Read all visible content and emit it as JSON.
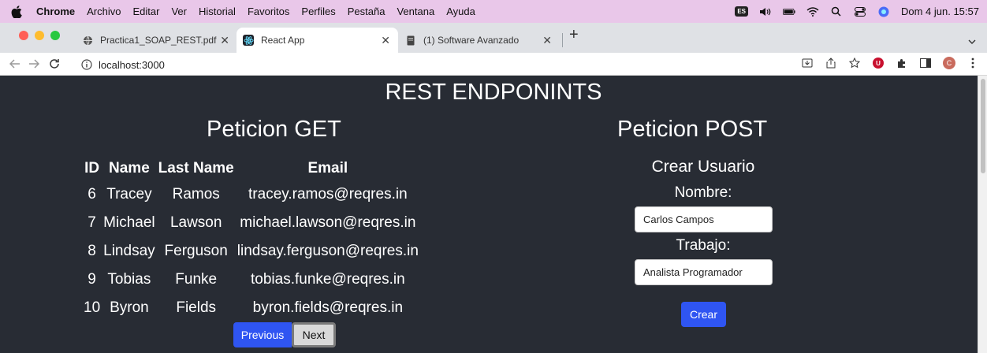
{
  "menubar": {
    "app_name": "Chrome",
    "items": [
      "Archivo",
      "Editar",
      "Ver",
      "Historial",
      "Favoritos",
      "Perfiles",
      "Pestaña",
      "Ventana",
      "Ayuda"
    ],
    "input_source": "ES",
    "datetime": "Dom 4 jun. 15:57"
  },
  "tabs": [
    {
      "title": "Practica1_SOAP_REST.pdf",
      "icon": "globe-icon"
    },
    {
      "title": "React App",
      "icon": "react-icon"
    },
    {
      "title": "(1) Software Avanzado",
      "icon": "document-icon"
    }
  ],
  "toolbar": {
    "url": "localhost:3000"
  },
  "page": {
    "main_title": "REST ENDPONINTS",
    "get_title": "Peticion GET",
    "post_title": "Peticion POST"
  },
  "table": {
    "headers": [
      "ID",
      "Name",
      "Last Name",
      "Email"
    ],
    "rows": [
      [
        "6",
        "Tracey",
        "Ramos",
        "tracey.ramos@reqres.in"
      ],
      [
        "7",
        "Michael",
        "Lawson",
        "michael.lawson@reqres.in"
      ],
      [
        "8",
        "Lindsay",
        "Ferguson",
        "lindsay.ferguson@reqres.in"
      ],
      [
        "9",
        "Tobias",
        "Funke",
        "tobias.funke@reqres.in"
      ],
      [
        "10",
        "Byron",
        "Fields",
        "byron.fields@reqres.in"
      ]
    ]
  },
  "pagination": {
    "previous_label": "Previous",
    "next_label": "Next"
  },
  "form": {
    "title": "Crear Usuario",
    "nombre_label": "Nombre:",
    "nombre_value": "Carlos Campos",
    "trabajo_label": "Trabajo:",
    "trabajo_value": "Analista Programador",
    "submit_label": "Crear"
  },
  "colors": {
    "page_bg": "#282c34",
    "primary_button": "#2f55f2",
    "menubar_bg": "#e9c7e9"
  }
}
